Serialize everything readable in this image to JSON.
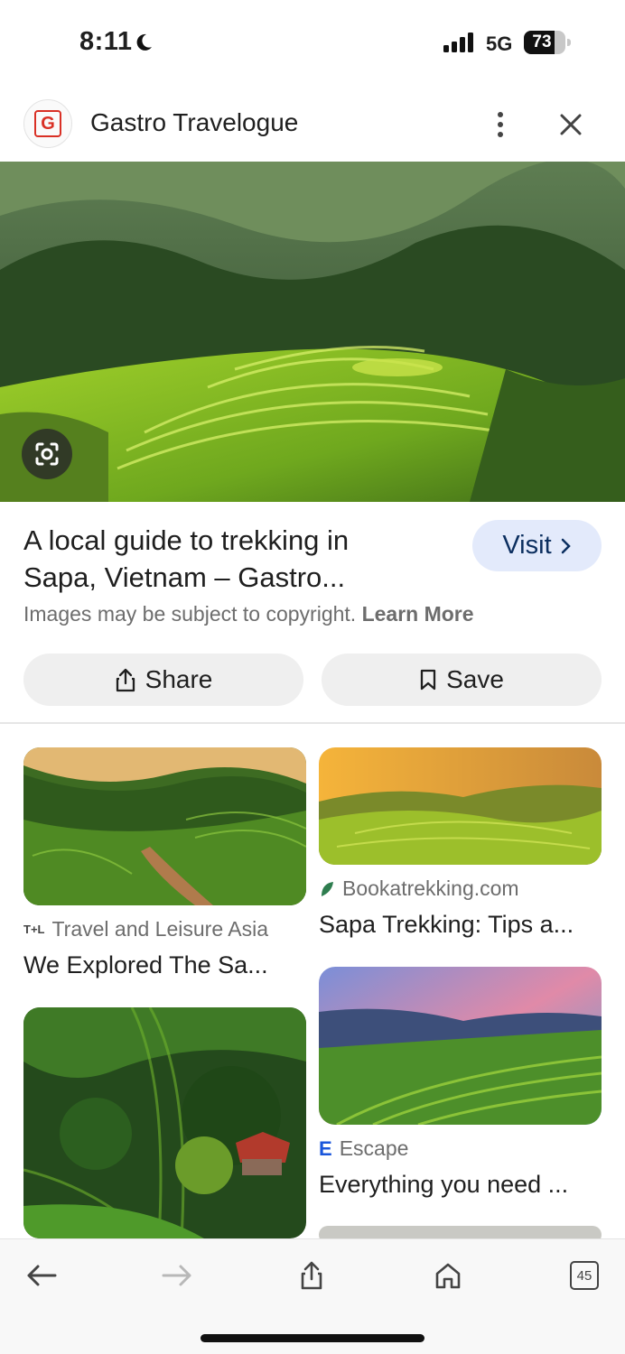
{
  "status_bar": {
    "time": "8:11",
    "network": "5G",
    "battery_level": "73",
    "battery_fraction": 0.73
  },
  "header": {
    "logo_letter": "G",
    "site_title": "Gastro Travelogue",
    "icons": [
      "more-vert-icon",
      "close-icon"
    ]
  },
  "result": {
    "title_line1": "A local guide to trekking in",
    "title_line2": "Sapa, Vietnam – Gastro...",
    "visit_label": "Visit",
    "copyright_text": "Images may be subject to copyright.",
    "learn_more": "Learn More",
    "share_label": "Share",
    "save_label": "Save"
  },
  "related": [
    {
      "source": "Travel and Leisure Asia",
      "favicon": "T+L",
      "title": "We Explored The Sa..."
    },
    {
      "source": "Bookatrekking.com",
      "favicon": "leaf",
      "title": "Sapa Trekking: Tips a..."
    },
    {
      "source": "Escape",
      "favicon": "E",
      "title": "Everything you need ..."
    }
  ],
  "toolbar": {
    "tab_count": "45",
    "icons": [
      "back-arrow-icon",
      "forward-arrow-icon",
      "share-icon",
      "home-icon",
      "tabs-icon"
    ]
  },
  "colors": {
    "accent_visit_bg": "#e3eafb",
    "visit_text": "#0b2e5f",
    "escape_blue": "#1a56db",
    "bookatrekking_green": "#2e7d4f"
  }
}
